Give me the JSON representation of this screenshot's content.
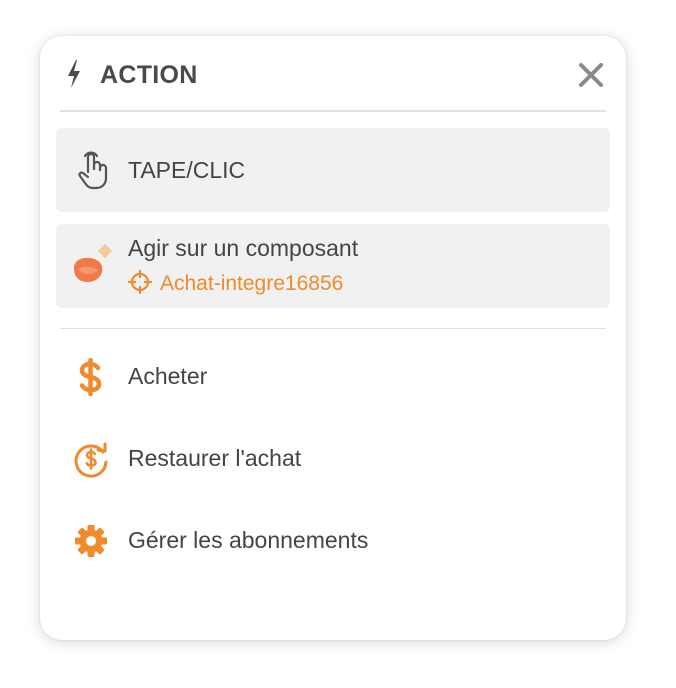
{
  "header": {
    "title": "ACTION",
    "icon": "bolt-icon",
    "close_icon": "close-icon"
  },
  "primary": {
    "tap": {
      "label": "TAPE/CLIC",
      "icon": "pointer-hand-icon"
    },
    "component": {
      "label": "Agir sur un composant",
      "target": "Achat-integre16856",
      "icon": "component-icon",
      "target_icon": "crosshair-icon"
    }
  },
  "actions": [
    {
      "label": "Acheter",
      "icon": "dollar-icon"
    },
    {
      "label": "Restaurer l'achat",
      "icon": "restore-purchase-icon"
    },
    {
      "label": "Gérer les abonnements",
      "icon": "gear-icon"
    }
  ],
  "colors": {
    "accent": "#f08a2a",
    "text": "#444444",
    "card_bg": "#f1f1f1",
    "icon_gray": "#555555"
  }
}
